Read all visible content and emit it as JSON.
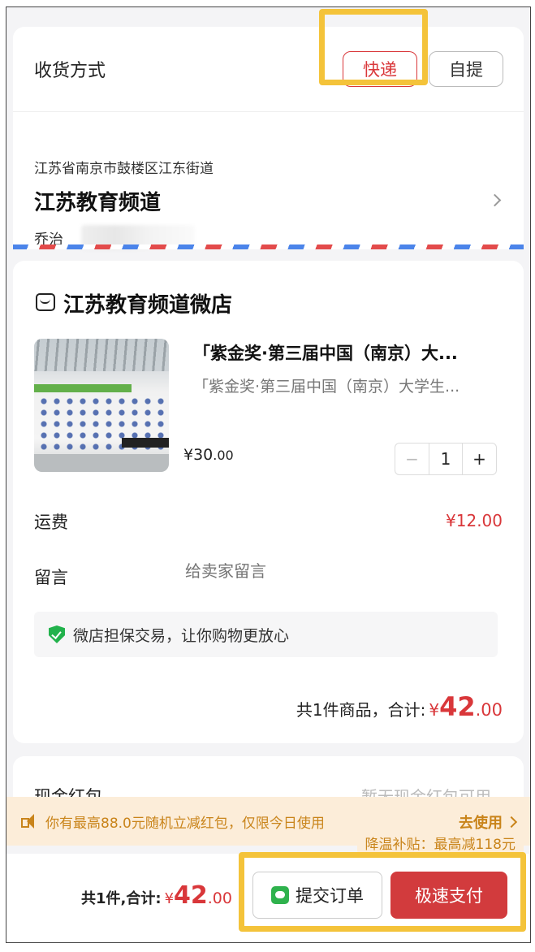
{
  "delivery": {
    "label": "收货方式",
    "options": [
      {
        "label": "快递",
        "selected": true
      },
      {
        "label": "自提",
        "selected": false
      }
    ]
  },
  "address": {
    "line": "江苏省南京市鼓楼区江东街道",
    "name": "江苏教育频道",
    "contact": "乔治"
  },
  "shop": {
    "name": "江苏教育频道微店",
    "product": {
      "title": "「紫金奖·第三届中国（南京）大...",
      "subtitle": "「紫金奖·第三届中国（南京）大学生...",
      "price_int": "¥30",
      "price_dec": ".00",
      "quantity": "1",
      "minus": "−",
      "plus": "+"
    },
    "shipping": {
      "label": "运费",
      "value": "¥12.00"
    },
    "message": {
      "label": "留言",
      "placeholder": "给卖家留言"
    },
    "guarantee": "微店担保交易，让你购物更放心",
    "subtotal": {
      "label": "共1件商品，合计:",
      "currency": "¥",
      "int": "42",
      "dec": ".00"
    }
  },
  "cash_redpacket": {
    "label": "现金红包",
    "value": "暂无现金红包可用"
  },
  "promo": {
    "text": "你有最高88.0元随机立减红包，仅限今日使用",
    "cta": "去使用",
    "subsidy": "降温补贴：最高减118元"
  },
  "bottom": {
    "total_label": "共1件,合计:",
    "currency": "¥",
    "int": "42",
    "dec": ".00",
    "submit_label": "提交订单",
    "pay_label": "极速支付"
  },
  "colors": {
    "accent_red": "#d9373a",
    "highlight_yellow": "#f4c33a",
    "promo_orange": "#c9841a",
    "success_green": "#22b24c"
  }
}
